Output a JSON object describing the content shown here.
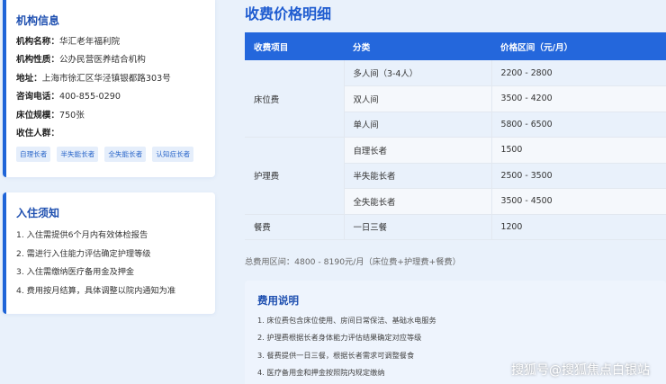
{
  "info": {
    "title": "机构信息",
    "rows": [
      {
        "key": "机构名称：",
        "value": "华汇老年福利院"
      },
      {
        "key": "机构性质：",
        "value": "公办民营医养结合机构"
      },
      {
        "key": "地址：",
        "value": "上海市徐汇区华泾镇银都路303号"
      },
      {
        "key": "咨询电话：",
        "value": "400-855-0290"
      },
      {
        "key": "床位规模：",
        "value": "750张"
      }
    ],
    "target_label": "收住人群：",
    "tags": [
      "自理长者",
      "半失能长者",
      "全失能长者",
      "认知症长者"
    ]
  },
  "notice": {
    "title": "入住须知",
    "items": [
      "1. 入住需提供6个月内有效体检报告",
      "2. 需进行入住能力评估确定护理等级",
      "3. 入住需缴纳医疗备用金及押金",
      "4. 费用按月结算，具体调整以院内通知为准"
    ]
  },
  "main": {
    "title": "收费价格明细",
    "headers": [
      "收费项目",
      "分类",
      "价格区间（元/月）"
    ],
    "groups": [
      {
        "category": "床位费",
        "rows": [
          {
            "sub": "多人间（3-4人）",
            "price": "2200 - 2800"
          },
          {
            "sub": "双人间",
            "price": "3500 - 4200"
          },
          {
            "sub": "单人间",
            "price": "5800 - 6500"
          }
        ]
      },
      {
        "category": "护理费",
        "rows": [
          {
            "sub": "自理长者",
            "price": "1500"
          },
          {
            "sub": "半失能长者",
            "price": "2500 - 3500"
          },
          {
            "sub": "全失能长者",
            "price": "3500 - 4500"
          }
        ]
      },
      {
        "category": "餐费",
        "rows": [
          {
            "sub": "一日三餐",
            "price": "1200"
          }
        ]
      }
    ],
    "total": "总费用区间：4800 - 8190元/月（床位费+护理费+餐费）"
  },
  "explain": {
    "title": "费用说明",
    "items": [
      "1. 床位费包含床位使用、房间日常保洁、基础水电服务",
      "2. 护理费根据长者身体能力评估结果确定对应等级",
      "3. 餐费提供一日三餐，根据长者需求可调整餐食",
      "4. 医疗备用金和押金按照院内规定缴纳"
    ]
  },
  "watermark": "搜狐号@搜狐焦点白银站",
  "colors": {
    "accent": "#1e64d8",
    "header_bg": "#2467dc",
    "page_bg": "#e9f1fb"
  }
}
